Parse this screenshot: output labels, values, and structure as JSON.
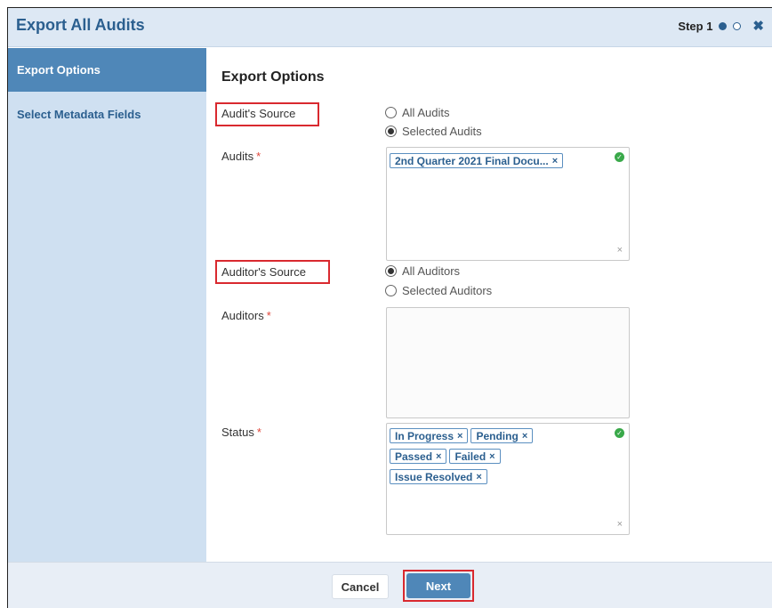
{
  "window": {
    "title": "Export All Audits",
    "step_label": "Step 1",
    "close_symbol": "✖"
  },
  "sidebar": {
    "items": [
      {
        "label": "Export Options",
        "active": true
      },
      {
        "label": "Select Metadata Fields",
        "active": false
      }
    ]
  },
  "main": {
    "section_title": "Export Options",
    "audit_source": {
      "label": "Audit's Source",
      "options": [
        {
          "label": "All Audits",
          "checked": false
        },
        {
          "label": "Selected Audits",
          "checked": true
        }
      ]
    },
    "audits": {
      "label": "Audits",
      "required_mark": "*",
      "tags": [
        "2nd Quarter 2021 Final Docu..."
      ],
      "valid_icon": "check-circle-icon",
      "clear_symbol": "×"
    },
    "auditor_source": {
      "label": "Auditor's Source",
      "options": [
        {
          "label": "All Auditors",
          "checked": true
        },
        {
          "label": "Selected Auditors",
          "checked": false
        }
      ]
    },
    "auditors": {
      "label": "Auditors",
      "required_mark": "*",
      "tags": []
    },
    "status": {
      "label": "Status",
      "required_mark": "*",
      "tags": [
        "In Progress",
        "Pending",
        "Passed",
        "Failed",
        "Issue Resolved"
      ],
      "valid_icon": "check-circle-icon",
      "clear_symbol": "×"
    }
  },
  "footer": {
    "cancel_label": "Cancel",
    "next_label": "Next"
  },
  "colors": {
    "brand": "#2b5f8f",
    "active_nav": "#4f87b8",
    "sidebar": "#cfe0f1",
    "highlight": "#d9292f",
    "required": "#e0463a",
    "valid": "#3aa94a"
  }
}
